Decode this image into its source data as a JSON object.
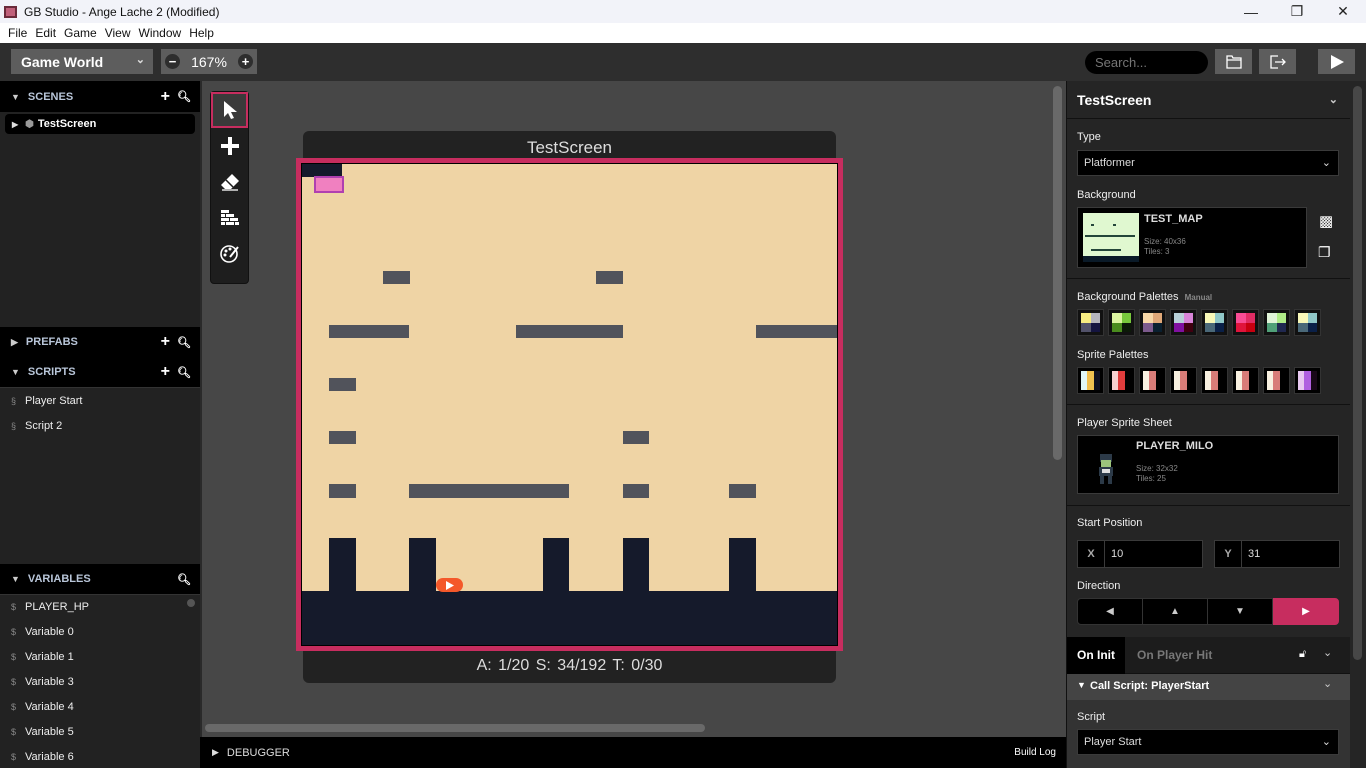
{
  "window": {
    "title": "GB Studio - Ange Lache 2 (Modified)",
    "controls": [
      "—",
      "❐",
      "✕"
    ]
  },
  "menu": [
    "File",
    "Edit",
    "Game",
    "View",
    "Window",
    "Help"
  ],
  "toolbar": {
    "world_select": "Game World",
    "zoom_value": "167%",
    "zoom_out": "−",
    "zoom_in": "+",
    "search_placeholder": "Search...",
    "icons": [
      "folder-open-icon",
      "export-icon",
      "play-icon"
    ]
  },
  "sidebar": {
    "scenes": {
      "label": "SCENES",
      "items": [
        "TestScreen"
      ]
    },
    "prefabs": {
      "label": "PREFABS"
    },
    "scripts": {
      "label": "SCRIPTS",
      "items": [
        "Player Start",
        "Script 2"
      ]
    },
    "variables": {
      "label": "VARIABLES",
      "items": [
        "PLAYER_HP",
        "Variable 0",
        "Variable 1",
        "Variable 3",
        "Variable 4",
        "Variable 5",
        "Variable 6"
      ]
    }
  },
  "tools": [
    "select-tool",
    "add-tool",
    "eraser-tool",
    "collisions-tool",
    "colorize-tool"
  ],
  "scene": {
    "name": "TestScreen",
    "info": "A: 1/20   S: 34/192   T: 0/30"
  },
  "bottom": {
    "debugger": "DEBUGGER",
    "build_log": "Build Log"
  },
  "inspector": {
    "title": "TestScreen",
    "type_label": "Type",
    "type_value": "Platformer",
    "background_label": "Background",
    "background": {
      "name": "TEST_MAP",
      "size": "Size:  40x36",
      "tiles": "Tiles:  3"
    },
    "bg_palettes_label": "Background Palettes",
    "bg_palettes_mode": "Manual",
    "bg_palettes": [
      [
        "#f7ec81",
        "#b4b4bc",
        "#52526a",
        "#141440"
      ],
      [
        "#dcf5a0",
        "#78c83c",
        "#4a8c1e",
        "#0c1a08"
      ],
      [
        "#f8d8a8",
        "#e0a878",
        "#7c5a8c",
        "#0a2030"
      ],
      [
        "#b8d0d8",
        "#d884d8",
        "#8010a0",
        "#400010"
      ],
      [
        "#f8f8b8",
        "#90c8c8",
        "#4a6878",
        "#0a2048"
      ],
      [
        "#f84c94",
        "#e02c64",
        "#e0143c",
        "#c80010"
      ],
      [
        "#e0f4d8",
        "#b0ec88",
        "#50a078",
        "#202850"
      ],
      [
        "#f8f8b8",
        "#90c8c8",
        "#4a6878",
        "#0a2048"
      ]
    ],
    "sprite_palettes_label": "Sprite Palettes",
    "sprite_palettes": [
      [
        "#e0f8f8",
        "#f0c050",
        "#101020"
      ],
      [
        "#f8d0d0",
        "#e03c3c",
        "#000000"
      ],
      [
        "#f8f0e0",
        "#d87c78",
        "#000000"
      ],
      [
        "#f8f0e0",
        "#d87c78",
        "#000000"
      ],
      [
        "#f8f0e0",
        "#d87c78",
        "#000000"
      ],
      [
        "#f8f0e0",
        "#d87c78",
        "#000000"
      ],
      [
        "#f8f0e0",
        "#d87c78",
        "#000000"
      ],
      [
        "#e8c8f0",
        "#b060e0",
        "#180818"
      ]
    ],
    "sprite_label": "Player Sprite Sheet",
    "sprite": {
      "name": "PLAYER_MILO",
      "size": "Size:  32x32",
      "tiles": "Tiles:  25"
    },
    "start_label": "Start Position",
    "x_label": "X",
    "x_value": "10",
    "y_label": "Y",
    "y_value": "31",
    "direction_label": "Direction",
    "directions": [
      "◀",
      "▲",
      "▼",
      "▶"
    ],
    "direction_selected": "right",
    "tabs": [
      "On Init",
      "On Player Hit"
    ],
    "event": {
      "title": "Call Script: PlayerStart",
      "script_label": "Script",
      "script_value": "Player Start"
    }
  },
  "colors": {
    "accent": "#c72d5f",
    "scene_bg": "#efd4a5",
    "blocks": "#51535b",
    "ground": "#151a2b"
  }
}
